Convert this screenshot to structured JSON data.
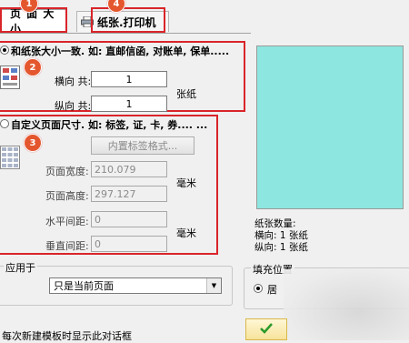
{
  "tabs": [
    {
      "label": "页 面 大 小",
      "badge": "1"
    },
    {
      "label": "纸张.打印机",
      "badge": "4"
    }
  ],
  "section2": {
    "badge": "2",
    "label": "和纸张大小一致. 如: 直邮信函, 对账单, 保单.....",
    "horizontal_label": "横向 共:",
    "horizontal_value": "1",
    "vertical_label": "纵向 共:",
    "vertical_value": "1",
    "unit": "张纸"
  },
  "section3": {
    "badge": "3",
    "label": "自定义页面尺寸. 如: 标签, 证, 卡, 券.... ...",
    "builtin_button": "内置标签格式...",
    "width_label": "页面宽度:",
    "width_value": "210.079",
    "height_label": "页面高度:",
    "height_value": "297.127",
    "unit_size": "毫米",
    "hspacing_label": "水平间距:",
    "hspacing_value": "0",
    "vspacing_label": "垂直间距:",
    "vspacing_value": "0",
    "unit_spacing": "毫米"
  },
  "apply": {
    "label": "应用于",
    "selected": "只是当前页面"
  },
  "preview": {
    "color": "#8ee6e0",
    "count_label": "纸张数量:",
    "horizontal_info": "横向: 1 张纸",
    "vertical_info": "纵向: 1 张纸"
  },
  "fill": {
    "label": "填充位置",
    "option": "居"
  },
  "footer": {
    "checkbox_label": "每次新建模板时显示此对话框"
  },
  "colors": {
    "highlight": "#d9252a",
    "badge": "#e4572e"
  }
}
